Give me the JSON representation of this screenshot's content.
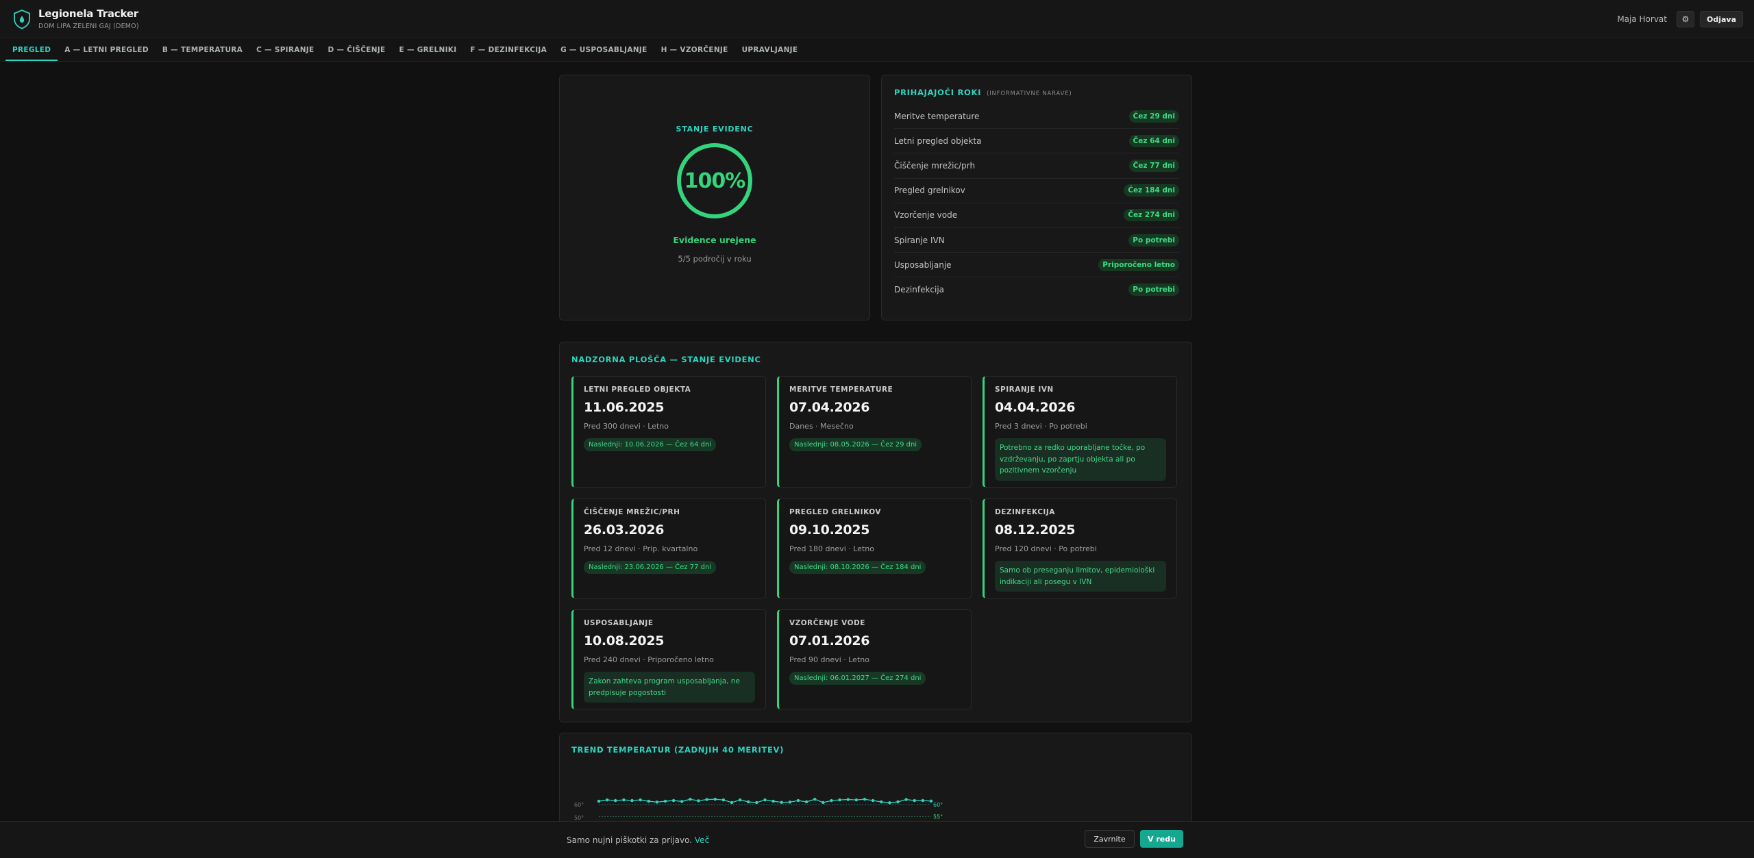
{
  "app": {
    "title": "Legionela Tracker",
    "subtitle": "DOM LIPA ZELENI GAJ (DEMO)"
  },
  "header": {
    "user_name": "Maja Horvat",
    "settings_icon": "gear-icon",
    "logout_label": "Odjava"
  },
  "tabs": [
    {
      "label": "PREGLED",
      "active": true
    },
    {
      "label": "A — LETNI PREGLED"
    },
    {
      "label": "B — TEMPERATURA"
    },
    {
      "label": "C — SPIRANJE"
    },
    {
      "label": "D — ČIŠČENJE"
    },
    {
      "label": "E — GRELNIKI"
    },
    {
      "label": "F — DEZINFEKCIJA"
    },
    {
      "label": "G — USPOSABLJANJE"
    },
    {
      "label": "H — VZORČENJE"
    },
    {
      "label": "UPRAVLJANJE"
    }
  ],
  "status": {
    "title": "STANJE EVIDENC",
    "percent": "100%",
    "text": "Evidence urejene",
    "sub": "5/5 področij v roku"
  },
  "deadlines": {
    "title": "PRIHAJAJOČI ROKI",
    "note": "(INFORMATIVNE NARAVE)",
    "items": [
      {
        "label": "Meritve temperature",
        "badge": "Čez 29 dni"
      },
      {
        "label": "Letni pregled objekta",
        "badge": "Čez 64 dni"
      },
      {
        "label": "Čiščenje mrežic/prh",
        "badge": "Čez 77 dni"
      },
      {
        "label": "Pregled grelnikov",
        "badge": "Čez 184 dni"
      },
      {
        "label": "Vzorčenje vode",
        "badge": "Čez 274 dni"
      },
      {
        "label": "Spiranje IVN",
        "badge": "Po potrebi"
      },
      {
        "label": "Usposabljanje",
        "badge": "Priporočeno letno"
      },
      {
        "label": "Dezinfekcija",
        "badge": "Po potrebi"
      }
    ]
  },
  "dashboard": {
    "title": "NADZORNA PLOŠČA — STANJE EVIDENC",
    "tiles": [
      {
        "title": "LETNI PREGLED OBJEKTA",
        "date": "11.06.2025",
        "meta": "Pred 300 dnevi · Letno",
        "next": "Naslednji: 10.06.2026 — Čez 64 dni"
      },
      {
        "title": "MERITVE TEMPERATURE",
        "date": "07.04.2026",
        "meta": "Danes · Mesečno",
        "next": "Naslednji: 08.05.2026 — Čez 29 dni"
      },
      {
        "title": "SPIRANJE IVN",
        "date": "04.04.2026",
        "meta": "Pred 3 dnevi · Po potrebi",
        "note": "Potrebno za redko uporabljane točke, po vzdrževanju, po zaprtju objekta ali po pozitivnem vzorčenju"
      },
      {
        "title": "ČIŠČENJE MREŽIC/PRH",
        "date": "26.03.2026",
        "meta": "Pred 12 dnevi · Prip. kvartalno",
        "next": "Naslednji: 23.06.2026 — Čez 77 dni"
      },
      {
        "title": "PREGLED GRELNIKOV",
        "date": "09.10.2025",
        "meta": "Pred 180 dnevi · Letno",
        "next": "Naslednji: 08.10.2026 — Čez 184 dni"
      },
      {
        "title": "DEZINFEKCIJA",
        "date": "08.12.2025",
        "meta": "Pred 120 dnevi · Po potrebi",
        "note": "Samo ob preseganju limitov, epidemiološki indikaciji ali posegu v IVN"
      },
      {
        "title": "USPOSABLJANJE",
        "date": "10.08.2025",
        "meta": "Pred 240 dnevi · Priporočeno letno",
        "note": "Zakon zahteva program usposabljanja, ne predpisuje pogostosti"
      },
      {
        "title": "VZORČENJE VODE",
        "date": "07.01.2026",
        "meta": "Pred 90 dnevi · Letno",
        "next": "Naslednji: 06.01.2027 — Čez 274 dni"
      }
    ]
  },
  "trend": {
    "title": "TREND TEMPERATUR (ZADNJIH 40 MERITEV)",
    "chart_data": {
      "type": "line",
      "y_tick_labels": [
        "60°",
        "50°"
      ],
      "ref_lines": [
        {
          "label": "60°",
          "color": "#2dd4bf"
        },
        {
          "label": "55°",
          "color": "#3fd985"
        }
      ],
      "ylim": [
        50,
        62
      ],
      "values": [
        60.5,
        61.5,
        61.0,
        61.5,
        61.0,
        61.5,
        60.5,
        59.8,
        60.5,
        61.0,
        60.3,
        62.0,
        60.8,
        61.8,
        62.0,
        61.5,
        59.5,
        61.5,
        60.0,
        59.5,
        61.5,
        60.5,
        59.6,
        59.8,
        61.0,
        60.0,
        62.0,
        59.5,
        61.0,
        61.5,
        61.8,
        61.5,
        62.0,
        61.0,
        60.0,
        59.3,
        60.0,
        61.8,
        61.0,
        61.0,
        60.6
      ]
    }
  },
  "cookie": {
    "text": "Samo nujni piškotki za prijavo.",
    "link": "Več",
    "close_label": "Zavrnite",
    "accept_label": "V redu"
  },
  "colors": {
    "accent": "#2dd4bf",
    "ok": "#34d47c",
    "background": "#111111"
  }
}
